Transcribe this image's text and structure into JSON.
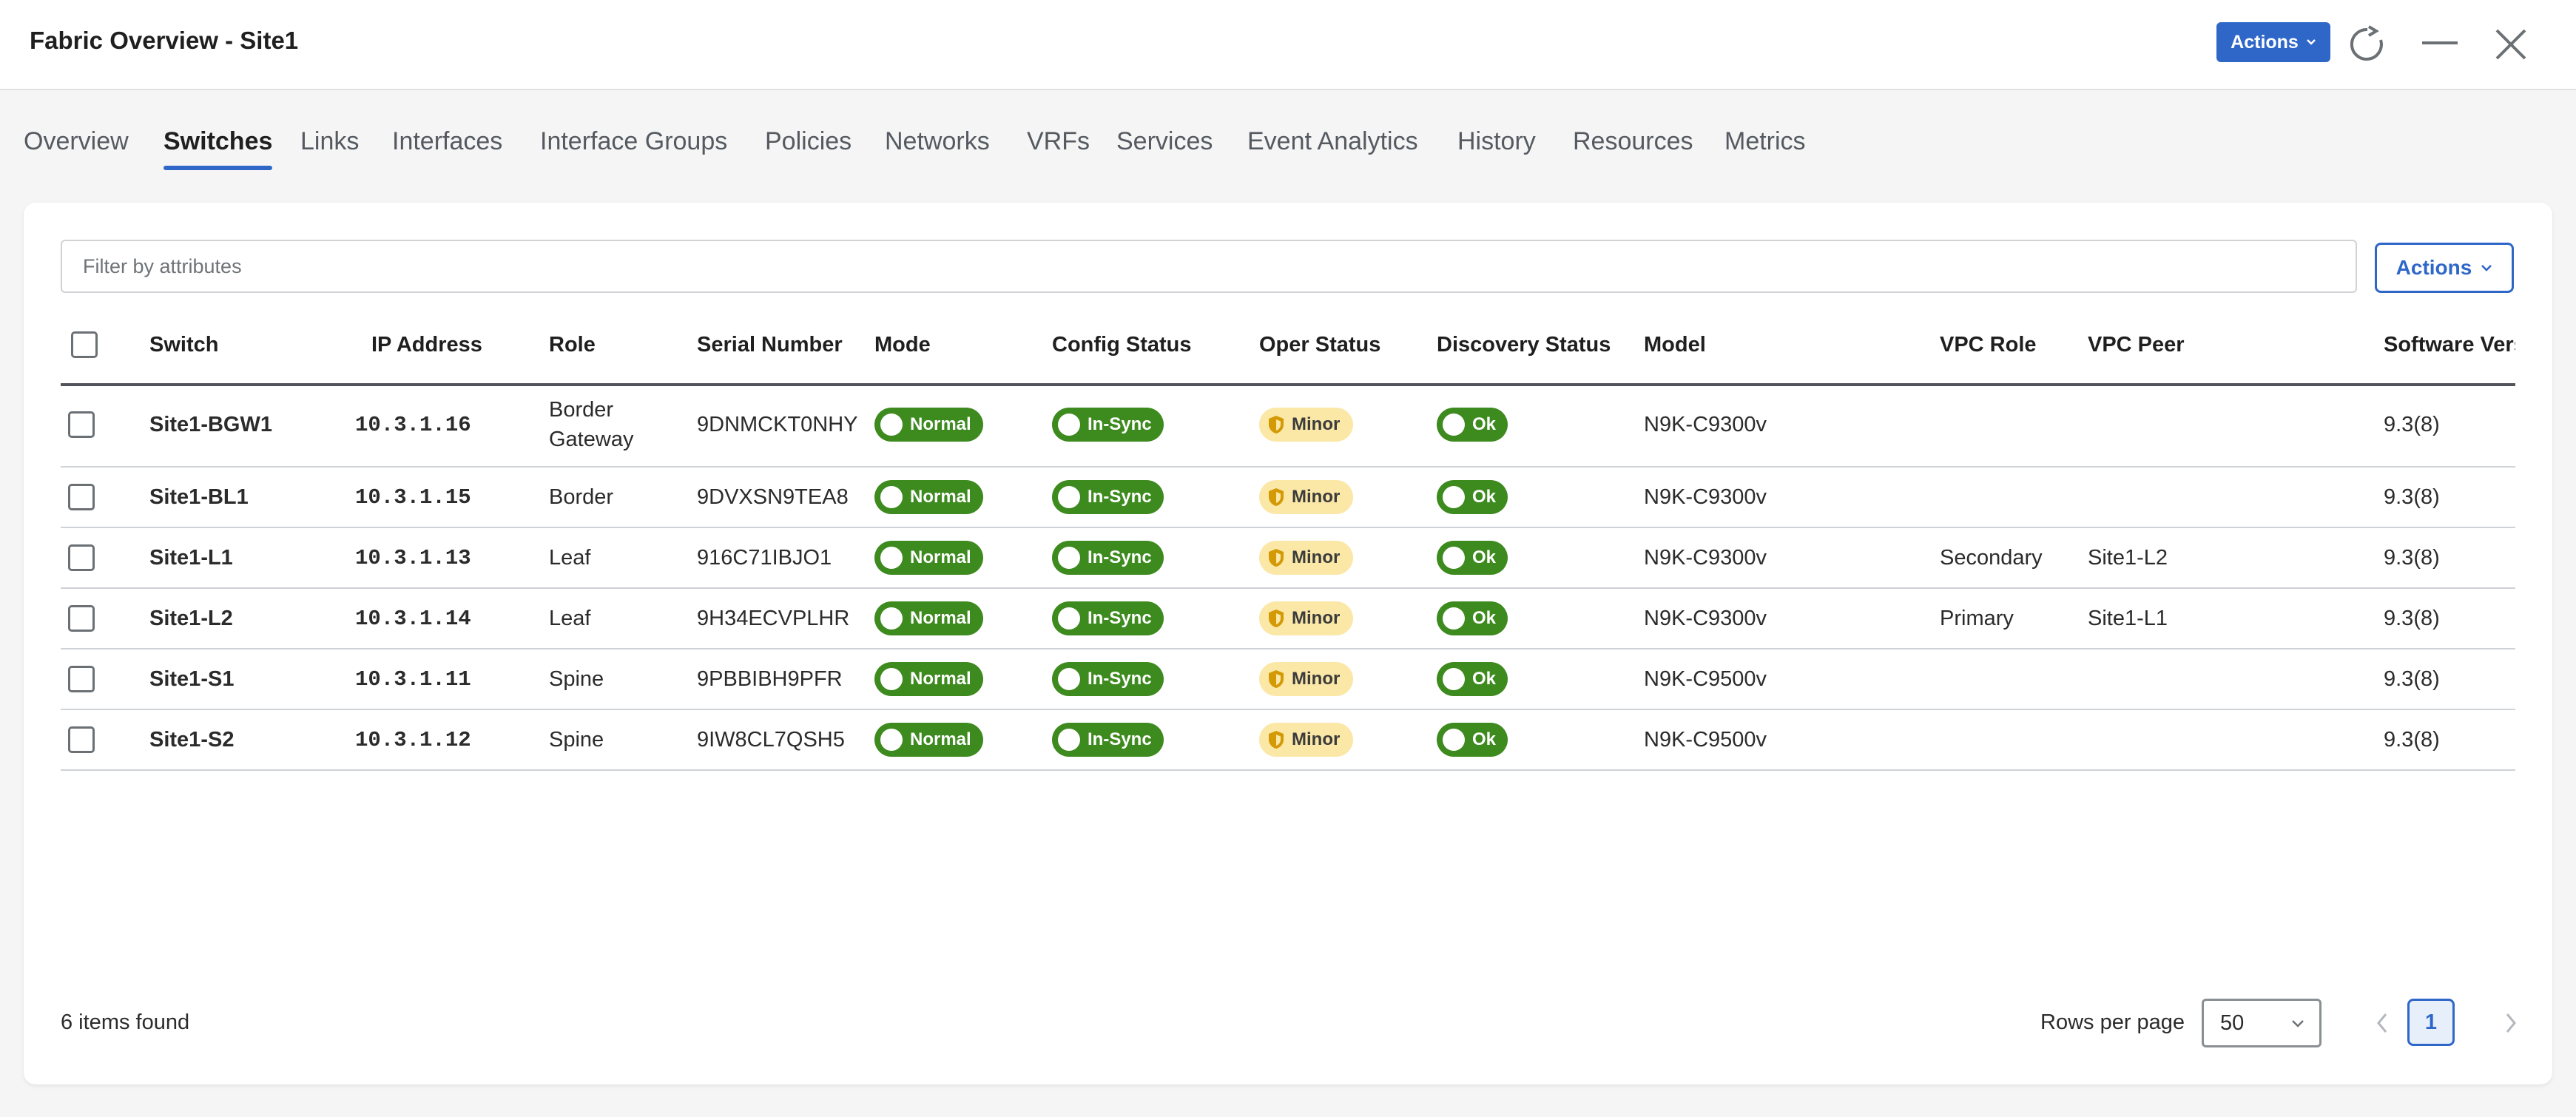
{
  "window": {
    "title": "Fabric Overview - Site1",
    "actions_label": "Actions"
  },
  "tabs": [
    {
      "label": "Overview"
    },
    {
      "label": "Switches"
    },
    {
      "label": "Links"
    },
    {
      "label": "Interfaces"
    },
    {
      "label": "Interface Groups"
    },
    {
      "label": "Policies"
    },
    {
      "label": "Networks"
    },
    {
      "label": "VRFs"
    },
    {
      "label": "Services"
    },
    {
      "label": "Event Analytics"
    },
    {
      "label": "History"
    },
    {
      "label": "Resources"
    },
    {
      "label": "Metrics"
    }
  ],
  "active_tab": "Switches",
  "filter": {
    "placeholder": "Filter by attributes",
    "value": ""
  },
  "card_actions_label": "Actions",
  "columns": [
    "Switch",
    "IP Address",
    "Role",
    "Serial Number",
    "Mode",
    "Config Status",
    "Oper Status",
    "Discovery Status",
    "Model",
    "VPC Role",
    "VPC Peer",
    "Software Version"
  ],
  "rows": [
    {
      "switch": "Site1-BGW1",
      "ip": "10.3.1.16",
      "role": "Border Gateway",
      "serial": "9DNMCKT0NHY",
      "mode": "Normal",
      "config": "In-Sync",
      "oper": "Minor",
      "discovery": "Ok",
      "model": "N9K-C9300v",
      "vpc_role": "",
      "vpc_peer": "",
      "software": "9.3(8)"
    },
    {
      "switch": "Site1-BL1",
      "ip": "10.3.1.15",
      "role": "Border",
      "serial": "9DVXSN9TEA8",
      "mode": "Normal",
      "config": "In-Sync",
      "oper": "Minor",
      "discovery": "Ok",
      "model": "N9K-C9300v",
      "vpc_role": "",
      "vpc_peer": "",
      "software": "9.3(8)"
    },
    {
      "switch": "Site1-L1",
      "ip": "10.3.1.13",
      "role": "Leaf",
      "serial": "916C71IBJO1",
      "mode": "Normal",
      "config": "In-Sync",
      "oper": "Minor",
      "discovery": "Ok",
      "model": "N9K-C9300v",
      "vpc_role": "Secondary",
      "vpc_peer": "Site1-L2",
      "software": "9.3(8)"
    },
    {
      "switch": "Site1-L2",
      "ip": "10.3.1.14",
      "role": "Leaf",
      "serial": "9H34ECVPLHR",
      "mode": "Normal",
      "config": "In-Sync",
      "oper": "Minor",
      "discovery": "Ok",
      "model": "N9K-C9300v",
      "vpc_role": "Primary",
      "vpc_peer": "Site1-L1",
      "software": "9.3(8)"
    },
    {
      "switch": "Site1-S1",
      "ip": "10.3.1.11",
      "role": "Spine",
      "serial": "9PBBIBH9PFR",
      "mode": "Normal",
      "config": "In-Sync",
      "oper": "Minor",
      "discovery": "Ok",
      "model": "N9K-C9500v",
      "vpc_role": "",
      "vpc_peer": "",
      "software": "9.3(8)"
    },
    {
      "switch": "Site1-S2",
      "ip": "10.3.1.12",
      "role": "Spine",
      "serial": "9IW8CL7QSH5",
      "mode": "Normal",
      "config": "In-Sync",
      "oper": "Minor",
      "discovery": "Ok",
      "model": "N9K-C9500v",
      "vpc_role": "",
      "vpc_peer": "",
      "software": "9.3(8)"
    }
  ],
  "footer": {
    "items_found": "6 items found",
    "rows_per_page_label": "Rows per page",
    "rows_per_page": "50",
    "current_page": "1"
  },
  "colors": {
    "accent": "#2f67c9",
    "ip_text": "#e8171e",
    "ok_green": "#3d8a1e",
    "minor_yellow": "#fbe7a6"
  },
  "icons": [
    "refresh-icon",
    "minimize-icon",
    "close-icon",
    "chevron-down-icon",
    "shield-warning-icon",
    "chevron-left-icon",
    "chevron-right-icon"
  ]
}
